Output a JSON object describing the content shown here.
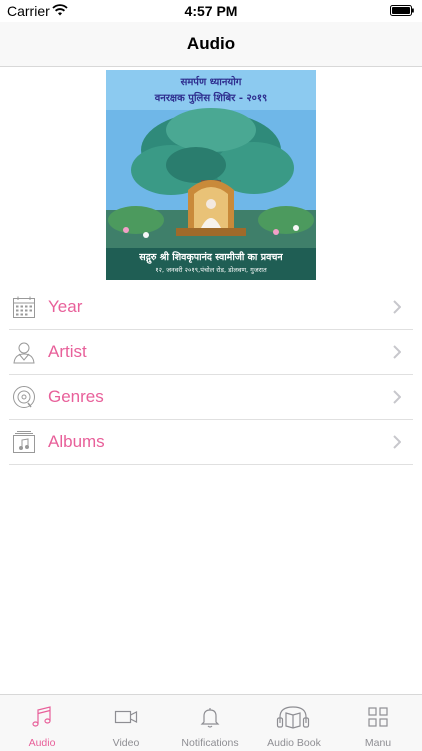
{
  "status_bar": {
    "carrier": "Carrier",
    "time": "4:57 PM"
  },
  "nav": {
    "title": "Audio"
  },
  "banner": {
    "title_line1": "समर्पण ध्यानयोग",
    "title_line2": "वनरक्षक पुलिस शिबिर - २०१९",
    "caption_line1": "सद्गुरु श्री शिवकृपानंद स्वामीजी का प्रवचन",
    "caption_line2": "१२, जनवरी २०१९,पंचोल रोड, डोलवण, गुजरात"
  },
  "list": [
    {
      "label": "Year",
      "icon": "calendar-icon"
    },
    {
      "label": "Artist",
      "icon": "artist-icon"
    },
    {
      "label": "Genres",
      "icon": "disc-icon"
    },
    {
      "label": "Albums",
      "icon": "album-icon"
    }
  ],
  "tabs": [
    {
      "label": "Audio",
      "icon": "music-note-icon",
      "active": true
    },
    {
      "label": "Video",
      "icon": "video-camera-icon",
      "active": false
    },
    {
      "label": "Notifications",
      "icon": "bell-icon",
      "active": false
    },
    {
      "label": "Audio Book",
      "icon": "headphones-book-icon",
      "active": false
    },
    {
      "label": "Manu",
      "icon": "grid-icon",
      "active": false
    }
  ],
  "colors": {
    "accent": "#e8609a",
    "inactive": "#8e8e93",
    "banner_bottom": "#1f5e54"
  }
}
